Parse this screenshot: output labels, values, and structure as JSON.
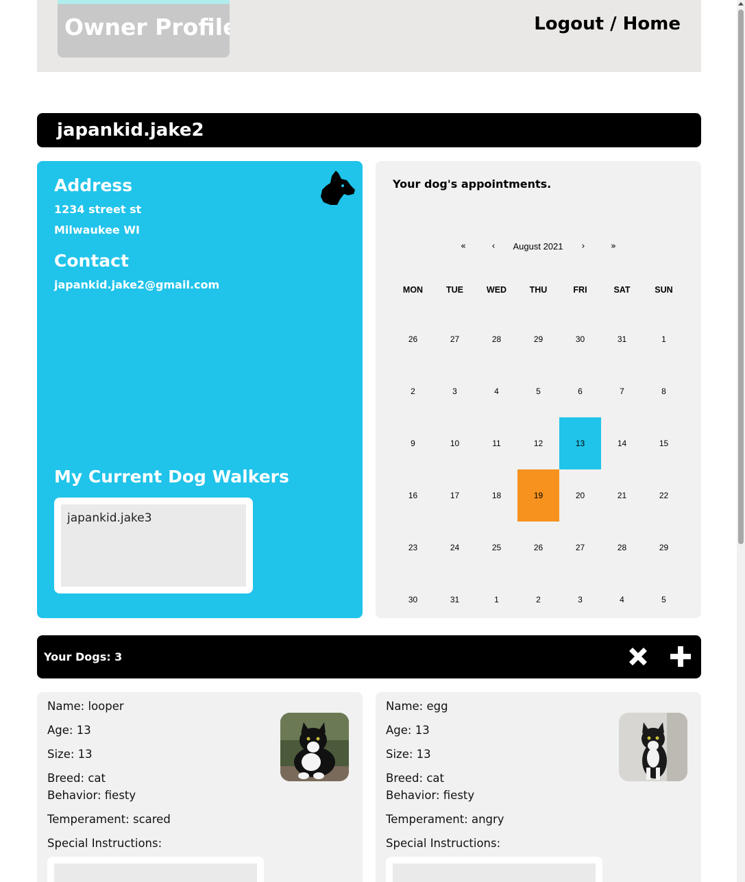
{
  "header": {
    "title": "Owner Profile",
    "logout_home": "Logout / Home"
  },
  "profile": {
    "username": "japankid.jake2"
  },
  "info": {
    "address_heading": "Address",
    "address_line1": "1234 street st",
    "address_line2": "Milwaukee WI",
    "contact_heading": "Contact",
    "email": "japankid.jake2@gmail.com",
    "walkers_heading": "My Current Dog Walkers",
    "walkers": [
      "japankid.jake3"
    ],
    "icon": "dog-head-icon"
  },
  "calendar": {
    "heading": "Your dog's appointments.",
    "nav_prev2": "«",
    "nav_prev": "‹",
    "month_label": "August 2021",
    "nav_next": "›",
    "nav_next2": "»",
    "weekdays": [
      "MON",
      "TUE",
      "WED",
      "THU",
      "FRI",
      "SAT",
      "SUN"
    ],
    "weeks": [
      [
        "26",
        "27",
        "28",
        "29",
        "30",
        "31",
        "1"
      ],
      [
        "2",
        "3",
        "4",
        "5",
        "6",
        "7",
        "8"
      ],
      [
        "9",
        "10",
        "11",
        "12",
        "13",
        "14",
        "15"
      ],
      [
        "16",
        "17",
        "18",
        "19",
        "20",
        "21",
        "22"
      ],
      [
        "23",
        "24",
        "25",
        "26",
        "27",
        "28",
        "29"
      ],
      [
        "30",
        "31",
        "1",
        "2",
        "3",
        "4",
        "5"
      ]
    ],
    "highlight_blue_day": "13",
    "highlight_orange_day": "19",
    "colors": {
      "blue": "#20c3ea",
      "orange": "#f7921e"
    }
  },
  "dogs_bar": {
    "label": "Your Dogs: 3",
    "remove_icon": "x-icon",
    "add_icon": "plus-icon"
  },
  "dogs": [
    {
      "name": "Name: looper",
      "age": "Age: 13",
      "size": "Size: 13",
      "breed": "Breed: cat",
      "behavior": "Behavior: fiesty",
      "temperament": "Temperament: scared",
      "special": "Special Instructions:"
    },
    {
      "name": "Name: egg",
      "age": "Age: 13",
      "size": "Size: 13",
      "breed": "Breed: cat",
      "behavior": "Behavior: fiesty",
      "temperament": "Temperament: angry",
      "special": "Special Instructions:"
    }
  ],
  "theme": {
    "accent_blue": "#20c3ea",
    "header_bg": "#e9e8e6",
    "panel_bg": "#f0f1f0"
  }
}
